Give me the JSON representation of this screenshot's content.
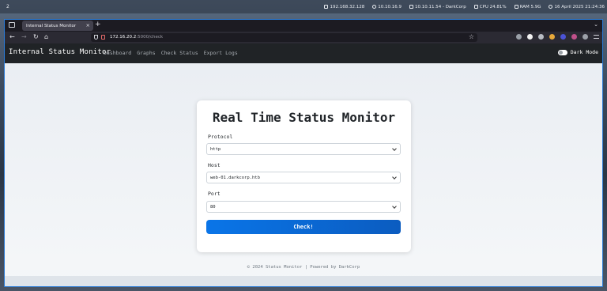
{
  "os": {
    "workspace": "2",
    "items": [
      {
        "icon": "network-icon",
        "text": "192.168.32.128"
      },
      {
        "icon": "vpn-icon",
        "text": "10.10.16.9"
      },
      {
        "icon": "target-icon",
        "text": "10.10.11.54 - DarkCorp"
      },
      {
        "icon": "cpu-icon",
        "text": "CPU 24.81%"
      },
      {
        "icon": "ram-icon",
        "text": "RAM 5.9G"
      },
      {
        "icon": "clock-icon",
        "text": "16 April 2025 21:24:36"
      }
    ]
  },
  "browser": {
    "tab_title": "Internal Status Monitor",
    "tab_close": "×",
    "new_tab": "+",
    "tab_overflow": "⌄",
    "url_host": "172.16.20.2",
    "url_path": ":5000/check",
    "nav": {
      "back": "←",
      "forward": "→",
      "reload": "↻",
      "home": "⌂",
      "star": "☆"
    }
  },
  "app": {
    "brand": "Internal Status Monitor",
    "nav_links": [
      "Dashboard",
      "Graphs",
      "Check Status",
      "Export Logs"
    ],
    "dark_mode_label": "Dark Mode",
    "title": "Real Time Status Monitor",
    "protocol_label": "Protocol",
    "protocol_value": "http",
    "host_label": "Host",
    "host_value": "web-01.darkcorp.htb",
    "port_label": "Port",
    "port_value": "80",
    "check_button": "Check!",
    "footer": "© 2024 Status Monitor | Powered by DarkCorp"
  },
  "colors": {
    "accent": "#0d6efd",
    "navbar": "#202326",
    "window_border": "#2b7bd6"
  }
}
